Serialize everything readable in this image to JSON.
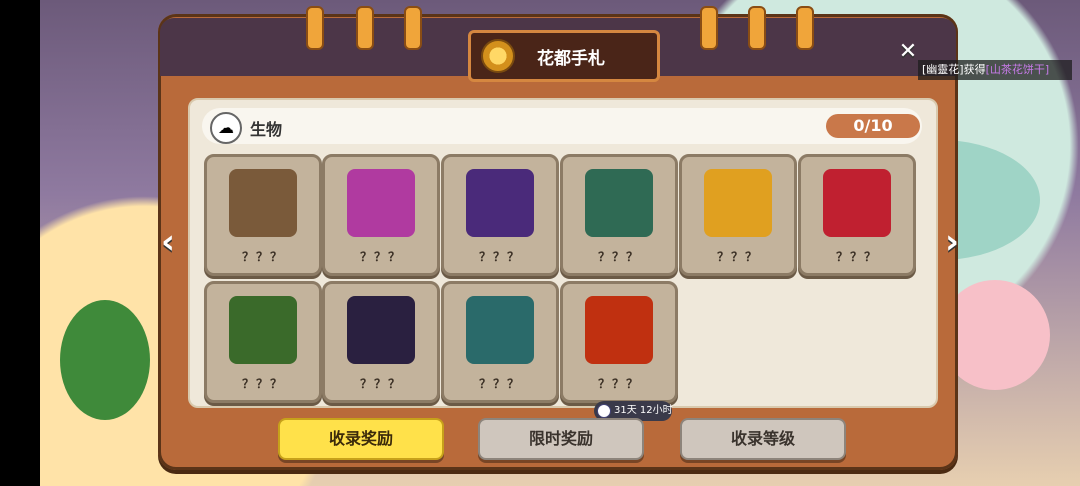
{
  "header": {
    "title": "花都手札"
  },
  "toast": {
    "prefix": "[幽靈花]获得",
    "item": "[山茶花饼干]"
  },
  "category": {
    "label": "生物",
    "progress": "0/10"
  },
  "cards": [
    {
      "label": "？？？",
      "color": "#7a5a3a"
    },
    {
      "label": "？？？",
      "color": "#b03aa0"
    },
    {
      "label": "？？？",
      "color": "#4a2a7a"
    },
    {
      "label": "？？？",
      "color": "#2f6a54"
    },
    {
      "label": "？？？",
      "color": "#e0a020"
    },
    {
      "label": "？？？",
      "color": "#c02030"
    },
    {
      "label": "？？？",
      "color": "#3a6a2a"
    },
    {
      "label": "？？？",
      "color": "#2a2040"
    },
    {
      "label": "？？？",
      "color": "#2a6a6a"
    },
    {
      "label": "？？？",
      "color": "#c03010"
    }
  ],
  "timer": {
    "text": "31天 12小时"
  },
  "buttons": {
    "collect_reward": "收录奖励",
    "limited_reward": "限时奖励",
    "collect_level": "收录等级"
  },
  "icons": {
    "close": "✕",
    "prev": "‹",
    "next": "›",
    "category": "☁"
  }
}
